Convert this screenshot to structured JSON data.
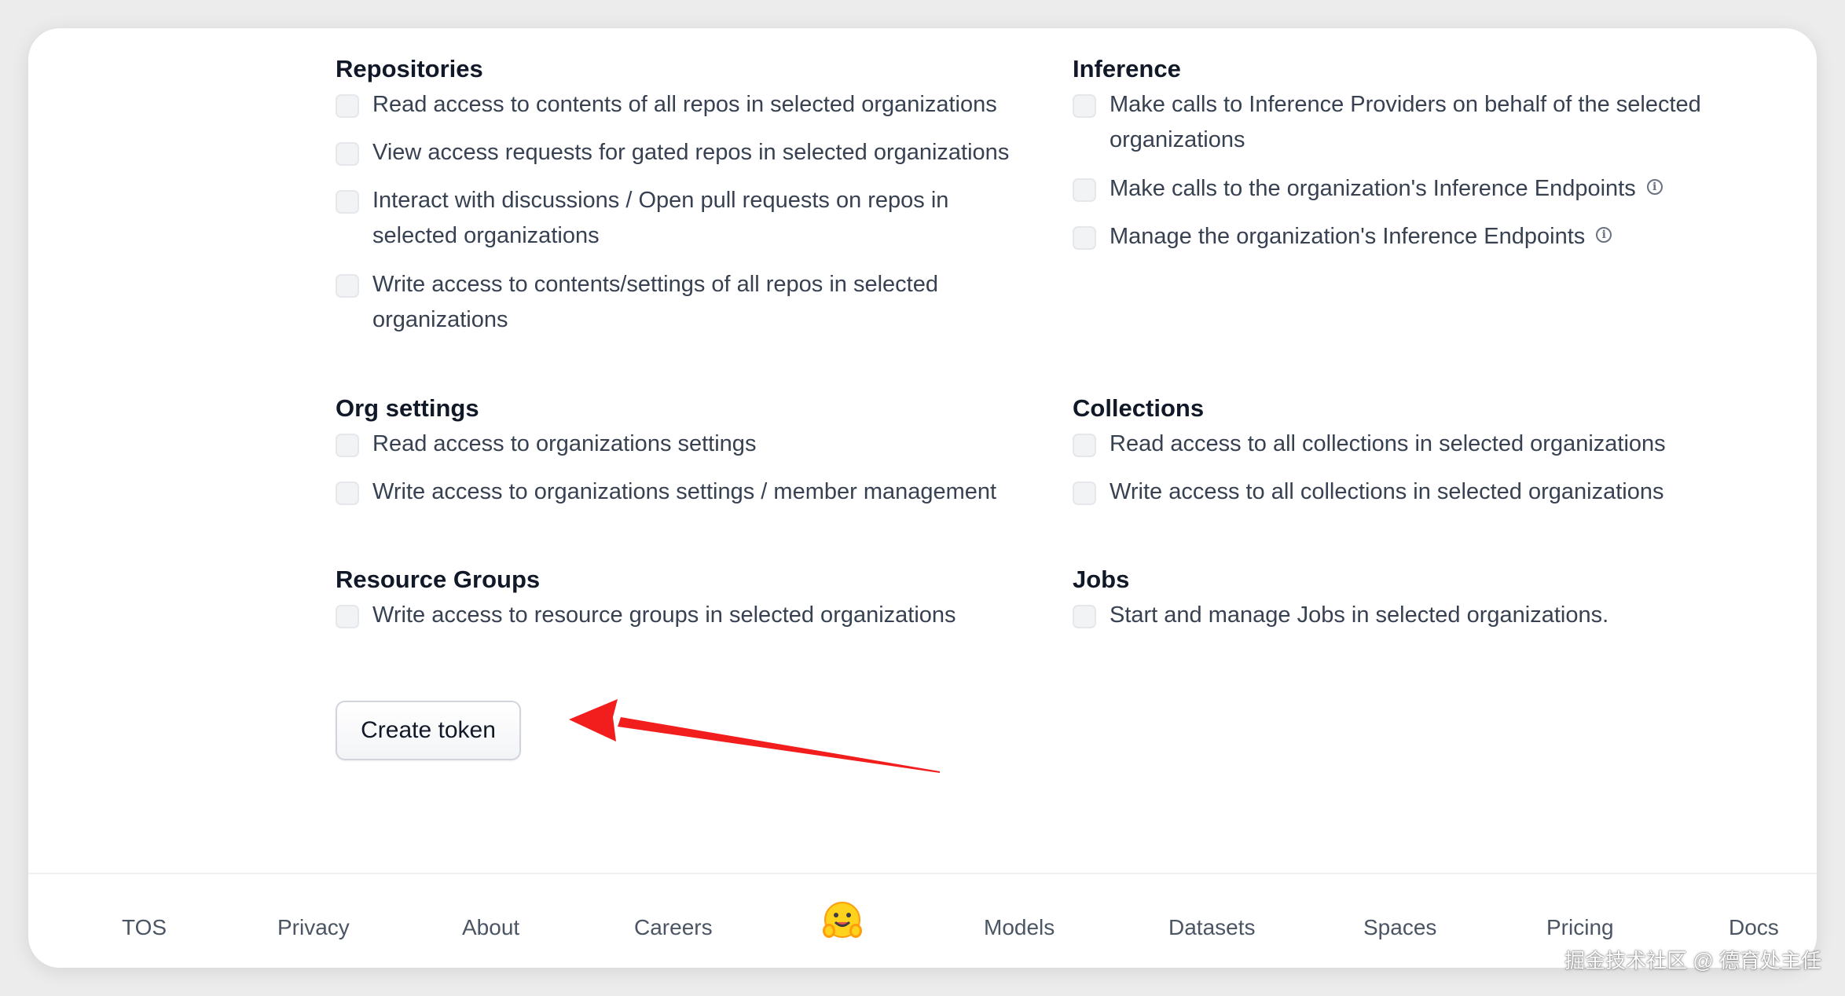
{
  "repositories": {
    "title": "Repositories",
    "options": [
      {
        "label": "Read access to contents of all repos in selected organizations"
      },
      {
        "label": "View access requests for gated repos in selected organizations"
      },
      {
        "label": "Interact with discussions / Open pull requests on repos in selected organizations"
      },
      {
        "label": "Write access to contents/settings of all repos in selected organizations"
      }
    ]
  },
  "inference": {
    "title": "Inference",
    "options": [
      {
        "label": "Make calls to Inference Providers on behalf of the selected organizations"
      },
      {
        "label": "Make calls to the organization's Inference Endpoints"
      },
      {
        "label": "Manage the organization's Inference Endpoints"
      }
    ],
    "info_icon": "ⓘ"
  },
  "org_settings": {
    "title": "Org settings",
    "options": [
      {
        "label": "Read access to organizations settings"
      },
      {
        "label": "Write access to organizations settings / member management"
      }
    ]
  },
  "collections": {
    "title": "Collections",
    "options": [
      {
        "label": "Read access to all collections in selected organizations"
      },
      {
        "label": "Write access to all collections in selected organizations"
      }
    ]
  },
  "resource_groups": {
    "title": "Resource Groups",
    "options": [
      {
        "label": "Write access to resource groups in selected organizations"
      }
    ]
  },
  "jobs": {
    "title": "Jobs",
    "options": [
      {
        "label": "Start and manage Jobs in selected organizations."
      }
    ]
  },
  "create_button": {
    "label": "Create token"
  },
  "annotation": {
    "arrow_color": "#f21d1d"
  },
  "footer": {
    "links": [
      "TOS",
      "Privacy",
      "About",
      "Careers",
      "Models",
      "Datasets",
      "Spaces",
      "Pricing",
      "Docs"
    ],
    "logo_icon": "hugging-face-logo"
  },
  "watermark": "掘金技术社区 @ 德育处主任"
}
